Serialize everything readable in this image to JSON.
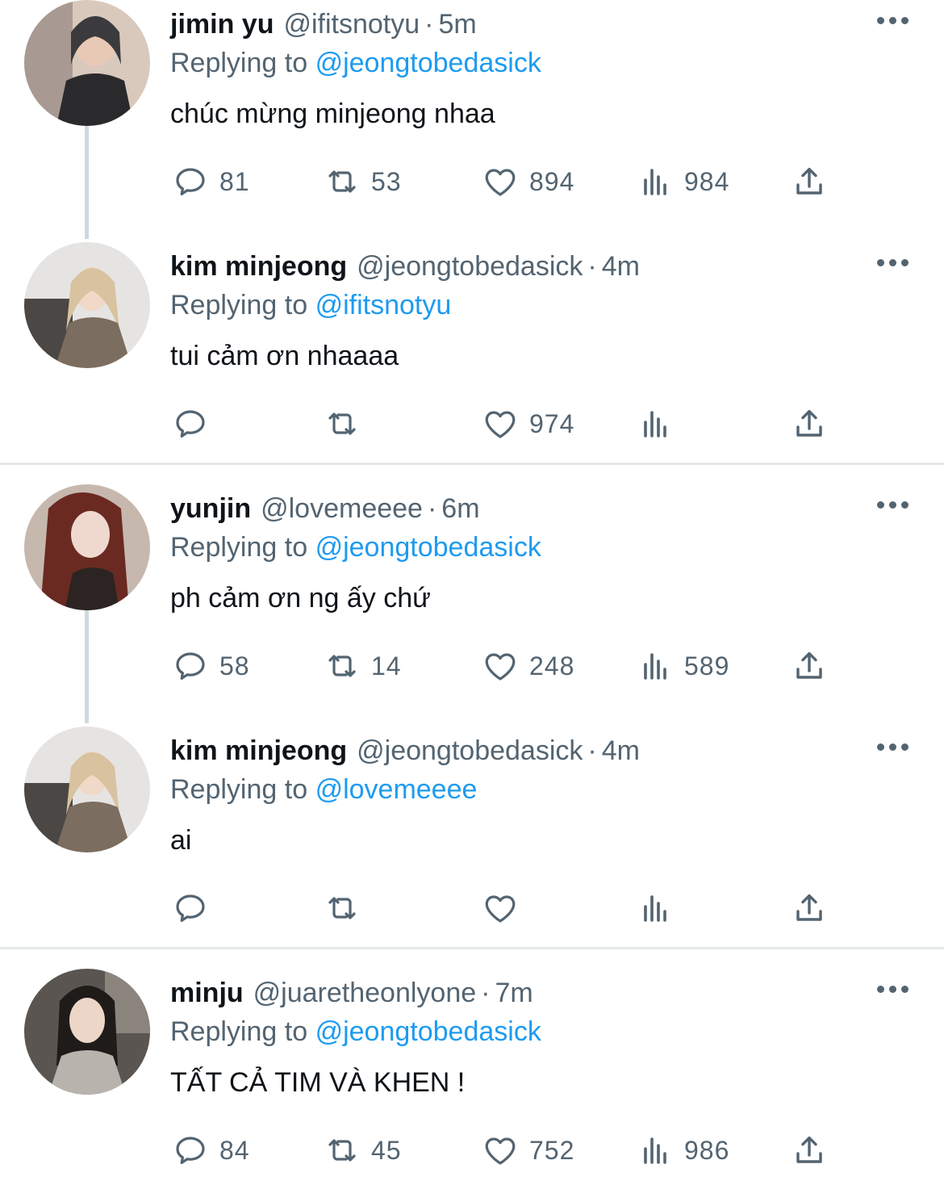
{
  "tweets": [
    {
      "name": "jimin yu",
      "handle": "@ifitsnotyu",
      "separator": "·",
      "time": "5m",
      "replying_prefix": "Replying to",
      "replying_to": "@jeongtobedasick",
      "text": "chúc mừng minjeong nhaa",
      "replies": "81",
      "retweets": "53",
      "likes": "894",
      "views": "984",
      "avatar_colors": [
        "#3b3a3c",
        "#a89a93",
        "#d9c9bd"
      ]
    },
    {
      "name": "kim minjeong",
      "handle": "@jeongtobedasick",
      "separator": "·",
      "time": "4m",
      "replying_prefix": "Replying to",
      "replying_to": "@ifitsnotyu",
      "text": "tui cảm ơn nhaaaa",
      "replies": "",
      "retweets": "",
      "likes": "974",
      "views": "",
      "avatar_colors": [
        "#e6e4e2",
        "#7b6d5f",
        "#d8c29f"
      ]
    },
    {
      "name": "yunjin",
      "handle": "@lovemeeee",
      "separator": "·",
      "time": "6m",
      "replying_prefix": "Replying to",
      "replying_to": "@jeongtobedasick",
      "text": "ph cảm ơn ng ấy chứ",
      "replies": "58",
      "retweets": "14",
      "likes": "248",
      "views": "589",
      "avatar_colors": [
        "#c7b8ae",
        "#6a2a22",
        "#efd9cf"
      ]
    },
    {
      "name": "kim minjeong",
      "handle": "@jeongtobedasick",
      "separator": "·",
      "time": "4m",
      "replying_prefix": "Replying to",
      "replying_to": "@lovemeeee",
      "text": "ai",
      "replies": "",
      "retweets": "",
      "likes": "",
      "views": "",
      "avatar_colors": [
        "#e6e4e2",
        "#7b6d5f",
        "#d8c29f"
      ]
    },
    {
      "name": "minju",
      "handle": "@juaretheonlyone",
      "separator": "·",
      "time": "7m",
      "replying_prefix": "Replying to",
      "replying_to": "@jeongtobedasick",
      "text": "TẤT CẢ TIM VÀ KHEN !",
      "replies": "84",
      "retweets": "45",
      "likes": "752",
      "views": "986",
      "avatar_colors": [
        "#5a5550",
        "#1f1b19",
        "#b9b3ad"
      ]
    }
  ],
  "icons": {
    "reply": "reply-icon",
    "retweet": "retweet-icon",
    "like": "heart-icon",
    "views": "views-icon",
    "share": "share-icon",
    "more": "more-icon"
  },
  "colors": {
    "text": "#0f1419",
    "muted": "#536471",
    "link": "#1d9bf0",
    "thread_line": "#cfd9de"
  }
}
